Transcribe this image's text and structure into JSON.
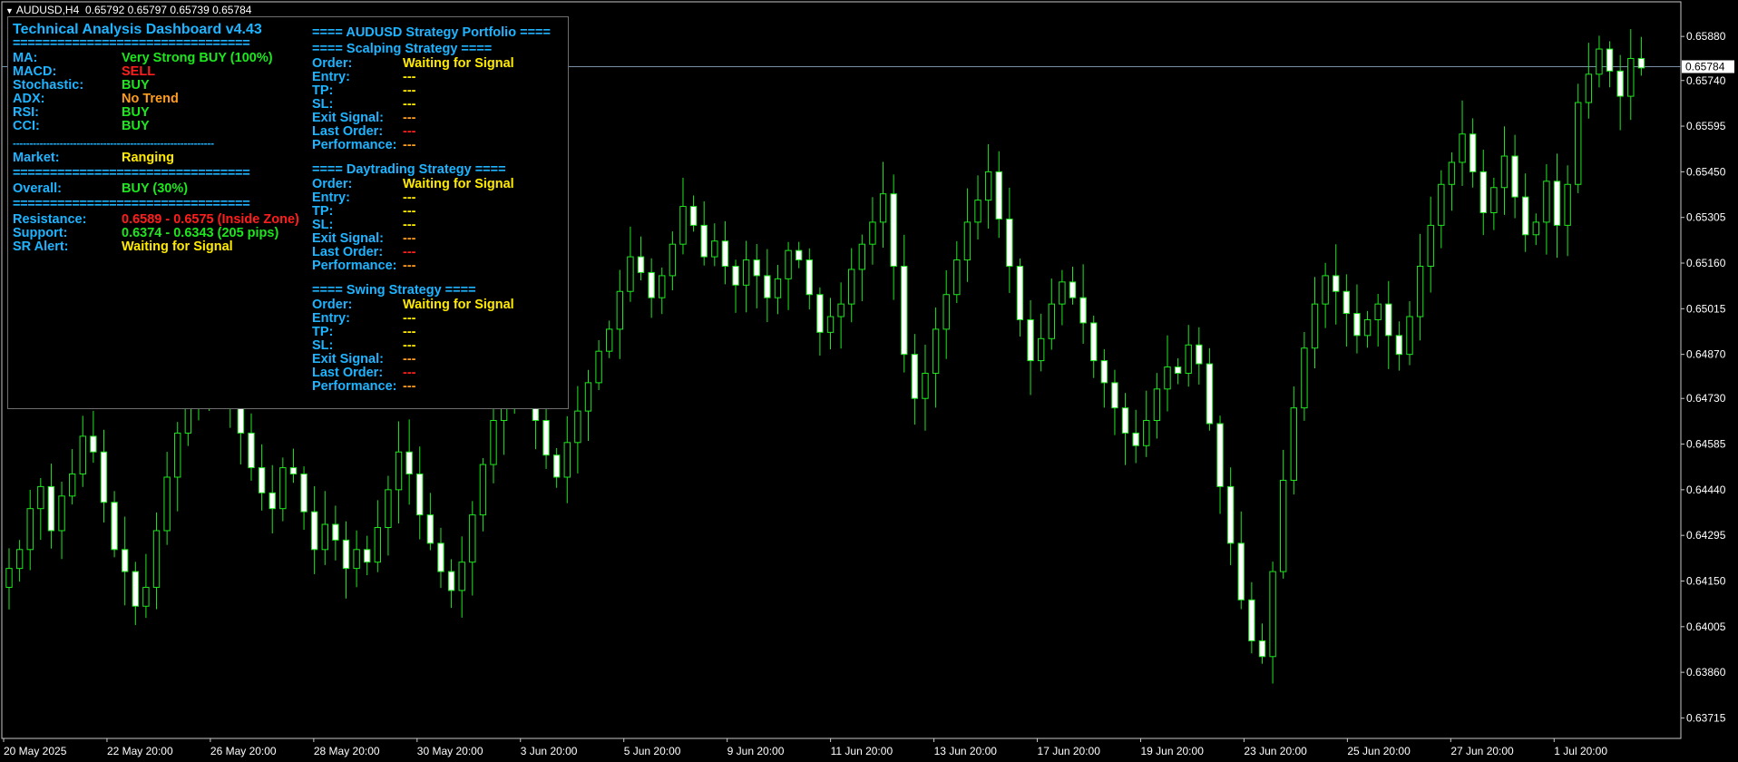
{
  "window": {
    "title": "AUDUSD,H4",
    "quote": "0.65792 0.65797 0.65739 0.65784"
  },
  "colors": {
    "background": "#000000",
    "bull_candle": "#1ee61e",
    "bear_candle_fill": "#ffffff",
    "axis_text": "#ffffff",
    "label_blue": "#1eb4ff",
    "green": "#1ee61e",
    "red": "#ff1e1e",
    "orange": "#ff9e1e",
    "yellow": "#ffeb00",
    "price_line": "#7a8fa6"
  },
  "dashboard": {
    "title": "Technical Analysis Dashboard v4.43",
    "separator": "================================",
    "dash_separator": "------------------------------------------------------------",
    "indicators": [
      {
        "label": "MA:",
        "value": "Very Strong BUY (100%)",
        "color": "green"
      },
      {
        "label": "MACD:",
        "value": "SELL",
        "color": "red"
      },
      {
        "label": "Stochastic:",
        "value": "BUY",
        "color": "green"
      },
      {
        "label": "ADX:",
        "value": "No Trend",
        "color": "orange"
      },
      {
        "label": "RSI:",
        "value": "BUY",
        "color": "green"
      },
      {
        "label": "CCI:",
        "value": "BUY",
        "color": "green"
      }
    ],
    "market": {
      "label": "Market:",
      "value": "Ranging"
    },
    "overall": {
      "label": "Overall:",
      "value": "BUY (30%)"
    },
    "resistance": {
      "label": "Resistance:",
      "value": "0.6589 - 0.6575 (Inside Zone)"
    },
    "support": {
      "label": "Support:",
      "value": "0.6374 - 0.6343 (205 pips)"
    },
    "sr_alert": {
      "label": "SR Alert:",
      "value": "Waiting for Signal"
    }
  },
  "portfolio": {
    "title": "==== AUDUSD Strategy Portfolio ====",
    "strategies": [
      {
        "title": "==== Scalping Strategy ====",
        "rows": [
          {
            "label": "Order:",
            "value": "Waiting for Signal",
            "color": "yellow"
          },
          {
            "label": "Entry:",
            "value": "---",
            "color": "yellow"
          },
          {
            "label": "TP:",
            "value": "---",
            "color": "yellow"
          },
          {
            "label": "SL:",
            "value": "---",
            "color": "yellow"
          },
          {
            "label": "Exit Signal:",
            "value": "---",
            "color": "orange"
          },
          {
            "label": "Last Order:",
            "value": "---",
            "color": "red"
          },
          {
            "label": "Performance:",
            "value": "---",
            "color": "orange"
          }
        ]
      },
      {
        "title": "==== Daytrading Strategy ====",
        "rows": [
          {
            "label": "Order:",
            "value": "Waiting for Signal",
            "color": "yellow"
          },
          {
            "label": "Entry:",
            "value": "---",
            "color": "yellow"
          },
          {
            "label": "TP:",
            "value": "---",
            "color": "yellow"
          },
          {
            "label": "SL:",
            "value": "---",
            "color": "yellow"
          },
          {
            "label": "Exit Signal:",
            "value": "---",
            "color": "orange"
          },
          {
            "label": "Last Order:",
            "value": "---",
            "color": "red"
          },
          {
            "label": "Performance:",
            "value": "---",
            "color": "orange"
          }
        ]
      },
      {
        "title": "==== Swing Strategy ====",
        "rows": [
          {
            "label": "Order:",
            "value": "Waiting for Signal",
            "color": "yellow"
          },
          {
            "label": "Entry:",
            "value": "---",
            "color": "yellow"
          },
          {
            "label": "TP:",
            "value": "---",
            "color": "yellow"
          },
          {
            "label": "SL:",
            "value": "---",
            "color": "yellow"
          },
          {
            "label": "Exit Signal:",
            "value": "---",
            "color": "orange"
          },
          {
            "label": "Last Order:",
            "value": "---",
            "color": "red"
          },
          {
            "label": "Performance:",
            "value": "---",
            "color": "orange"
          }
        ]
      }
    ]
  },
  "chart_data": {
    "type": "candlestick",
    "symbol": "AUDUSD",
    "timeframe": "H4",
    "current_price": 0.65784,
    "ylim": [
      0.6365,
      0.6599
    ],
    "y_ticks": [
      0.6588,
      0.6574,
      0.65595,
      0.6545,
      0.65305,
      0.6516,
      0.65015,
      0.6487,
      0.6473,
      0.64585,
      0.6444,
      0.64295,
      0.6415,
      0.64005,
      0.6386,
      0.63715
    ],
    "y_tick_labels": [
      "0.65880",
      "0.65740",
      "0.65595",
      "0.65450",
      "0.65305",
      "0.65160",
      "0.65015",
      "0.64870",
      "0.64730",
      "0.64585",
      "0.64440",
      "0.64295",
      "0.64150",
      "0.64005",
      "0.63860",
      "0.63715"
    ],
    "current_price_label": "0.65784",
    "x_tick_labels": [
      "20 May 2025",
      "22 May 20:00",
      "26 May 20:00",
      "28 May 20:00",
      "30 May 20:00",
      "3 Jun 20:00",
      "5 Jun 20:00",
      "9 Jun 20:00",
      "11 Jun 20:00",
      "13 Jun 20:00",
      "17 Jun 20:00",
      "19 Jun 20:00",
      "23 Jun 20:00",
      "25 Jun 20:00",
      "27 Jun 20:00",
      "1 Jul 20:00"
    ],
    "closes": [
      0.6419,
      0.6425,
      0.6438,
      0.6445,
      0.6431,
      0.6442,
      0.6449,
      0.6461,
      0.6456,
      0.644,
      0.6425,
      0.6418,
      0.6407,
      0.6413,
      0.6431,
      0.6448,
      0.6462,
      0.6471,
      0.6478,
      0.6491,
      0.6486,
      0.6474,
      0.6462,
      0.6451,
      0.6443,
      0.6438,
      0.6451,
      0.6449,
      0.6437,
      0.6425,
      0.6433,
      0.6428,
      0.6419,
      0.6425,
      0.6421,
      0.6432,
      0.6444,
      0.6456,
      0.6449,
      0.6436,
      0.6427,
      0.6418,
      0.6412,
      0.6421,
      0.6436,
      0.6452,
      0.6466,
      0.6478,
      0.6488,
      0.6477,
      0.6466,
      0.6455,
      0.6448,
      0.6459,
      0.6469,
      0.6478,
      0.6488,
      0.6495,
      0.6507,
      0.6518,
      0.6513,
      0.6505,
      0.6512,
      0.6522,
      0.6534,
      0.6528,
      0.6518,
      0.6523,
      0.6515,
      0.6509,
      0.6517,
      0.6512,
      0.6505,
      0.6511,
      0.652,
      0.6517,
      0.6506,
      0.6494,
      0.6499,
      0.6503,
      0.6514,
      0.6522,
      0.6529,
      0.6538,
      0.6515,
      0.6487,
      0.6473,
      0.6481,
      0.6495,
      0.6506,
      0.6517,
      0.6529,
      0.6536,
      0.6545,
      0.653,
      0.6515,
      0.6498,
      0.6485,
      0.6492,
      0.6503,
      0.651,
      0.6505,
      0.6497,
      0.6485,
      0.6478,
      0.647,
      0.6462,
      0.6458,
      0.6466,
      0.6476,
      0.6483,
      0.6481,
      0.649,
      0.6484,
      0.6465,
      0.6445,
      0.6427,
      0.6409,
      0.6396,
      0.6391,
      0.6418,
      0.6447,
      0.647,
      0.6489,
      0.6503,
      0.6512,
      0.6507,
      0.65,
      0.6493,
      0.6498,
      0.6503,
      0.6493,
      0.6487,
      0.6499,
      0.6515,
      0.6528,
      0.6541,
      0.6548,
      0.6557,
      0.6545,
      0.6532,
      0.654,
      0.655,
      0.6537,
      0.6525,
      0.6529,
      0.6542,
      0.6528,
      0.6541,
      0.6567,
      0.6576,
      0.6584,
      0.6577,
      0.6569,
      0.6581,
      0.6578
    ]
  }
}
